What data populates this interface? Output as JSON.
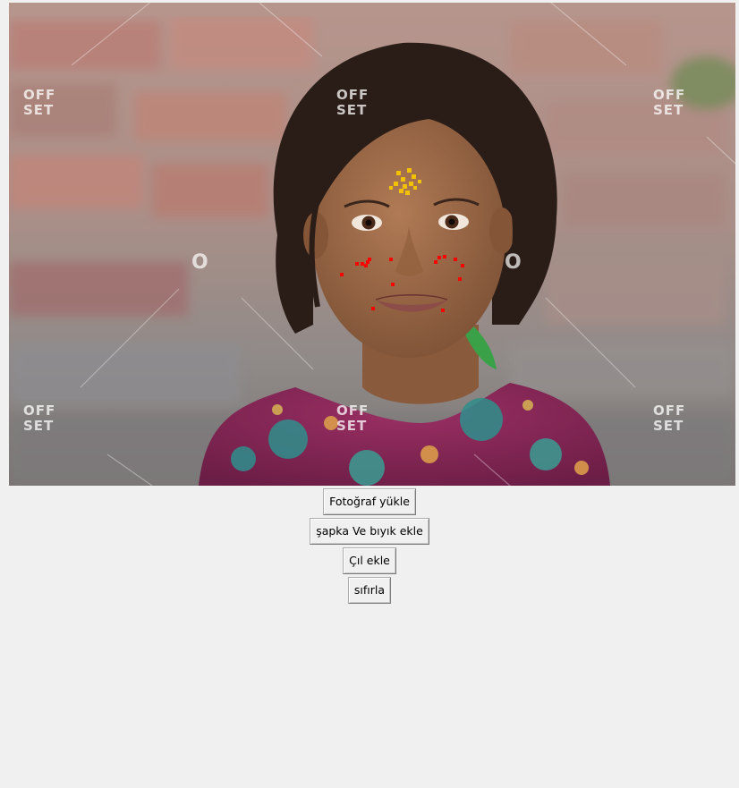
{
  "photo": {
    "description_icon": "portrait-photo",
    "watermark": "OFFSET",
    "overlay": {
      "tilak_color": "#f2c200",
      "landmark_color": "#ff0000"
    }
  },
  "buttons": {
    "upload_label": "Fotoğraf yükle",
    "hat_mustache_label": "şapka Ve bıyık ekle",
    "freckles_label": "Çıl ekle",
    "reset_label": "sıfırla"
  }
}
